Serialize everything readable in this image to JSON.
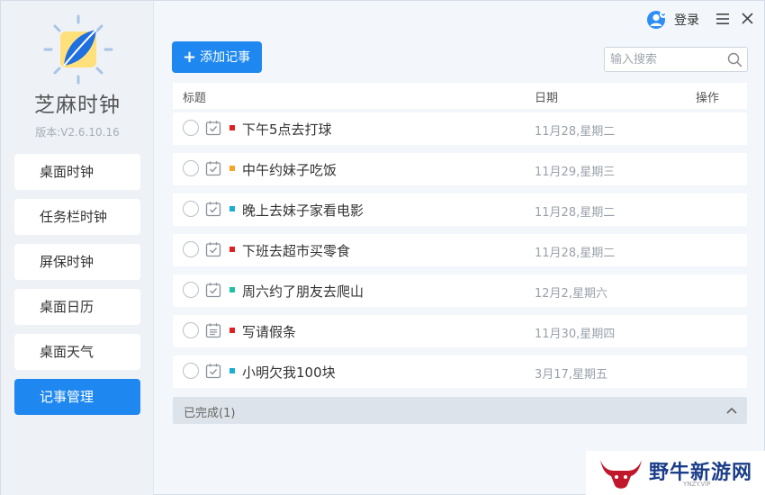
{
  "app": {
    "title": "芝麻时钟",
    "version": "版本:V2.6.10.16"
  },
  "titlebar": {
    "login_label": "登录"
  },
  "sidebar": {
    "items": [
      {
        "label": "桌面时钟",
        "active": false
      },
      {
        "label": "任务栏时钟",
        "active": false
      },
      {
        "label": "屏保时钟",
        "active": false
      },
      {
        "label": "桌面日历",
        "active": false
      },
      {
        "label": "桌面天气",
        "active": false
      },
      {
        "label": "记事管理",
        "active": true
      }
    ]
  },
  "toolbar": {
    "add_label": "添加记事",
    "search_placeholder": "输入搜索"
  },
  "table": {
    "headers": {
      "title": "标题",
      "date": "日期",
      "action": "操作"
    },
    "rows": [
      {
        "title": "下午5点去打球",
        "date": "11月28,星期二",
        "color": "#e02020",
        "icon": "task-check-icon"
      },
      {
        "title": "中午约妹子吃饭",
        "date": "11月29,星期三",
        "color": "#f5a623",
        "icon": "task-check-icon"
      },
      {
        "title": "晚上去妹子家看电影",
        "date": "11月28,星期二",
        "color": "#1aaed4",
        "icon": "task-check-icon"
      },
      {
        "title": "下班去超市买零食",
        "date": "11月28,星期二",
        "color": "#e02020",
        "icon": "task-check-icon"
      },
      {
        "title": "周六约了朋友去爬山",
        "date": "12月2,星期六",
        "color": "#1fc0a4",
        "icon": "task-check-icon"
      },
      {
        "title": "写请假条",
        "date": "11月30,星期四",
        "color": "#e02020",
        "icon": "task-list-icon"
      },
      {
        "title": "小明欠我100块",
        "date": "3月17,星期五",
        "color": "#1aaed4",
        "icon": "task-check-icon"
      }
    ]
  },
  "completed": {
    "label": "已完成(1)"
  },
  "watermark": {
    "text": "野牛新游网",
    "sub": "YNZY.VIP"
  },
  "colors": {
    "accent": "#1e88f0"
  }
}
